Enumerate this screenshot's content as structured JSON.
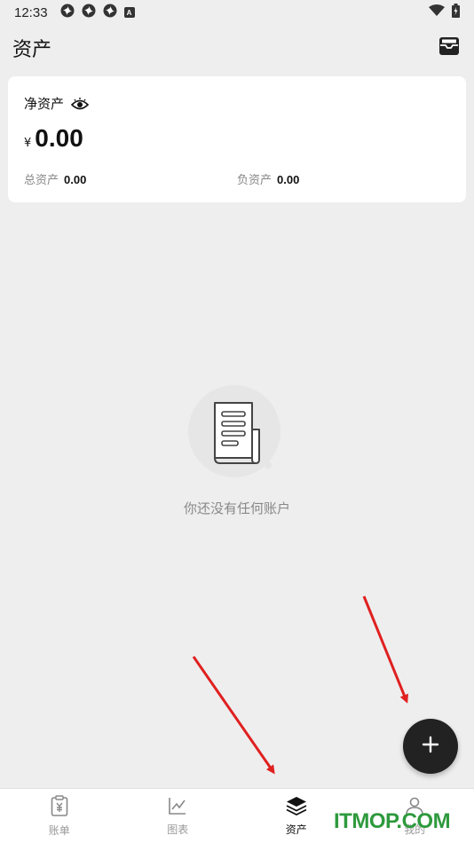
{
  "status_bar": {
    "time": "12:33",
    "notification_icons": [
      "pinwheel-icon",
      "pinwheel-icon",
      "pinwheel-icon",
      "a-badge-icon"
    ],
    "notif_badge_letter": "A",
    "right_icons": [
      "wifi-icon",
      "battery-charging-icon"
    ]
  },
  "header": {
    "title": "资产",
    "action_icon": "inbox-icon"
  },
  "summary": {
    "net_label": "净资产",
    "currency": "¥",
    "net_value": "0.00",
    "total_assets_label": "总资产",
    "total_assets_value": "0.00",
    "liabilities_label": "负资产",
    "liabilities_value": "0.00"
  },
  "empty_state": {
    "message": "你还没有任何账户",
    "icon": "receipt-document-icon"
  },
  "fab": {
    "icon": "plus-icon"
  },
  "nav": {
    "items": [
      {
        "label": "账单",
        "icon": "bill-clipboard-icon",
        "active": false
      },
      {
        "label": "图表",
        "icon": "line-chart-icon",
        "active": false
      },
      {
        "label": "资产",
        "icon": "layers-icon",
        "active": true
      },
      {
        "label": "我的",
        "icon": "user-icon",
        "active": false
      }
    ]
  },
  "watermark": {
    "text": "ITMOP.COM"
  },
  "colors": {
    "background": "#eeeeee",
    "card": "#ffffff",
    "fab": "#222222",
    "arrow": "#e02020",
    "watermark": "#2e9a3d"
  }
}
